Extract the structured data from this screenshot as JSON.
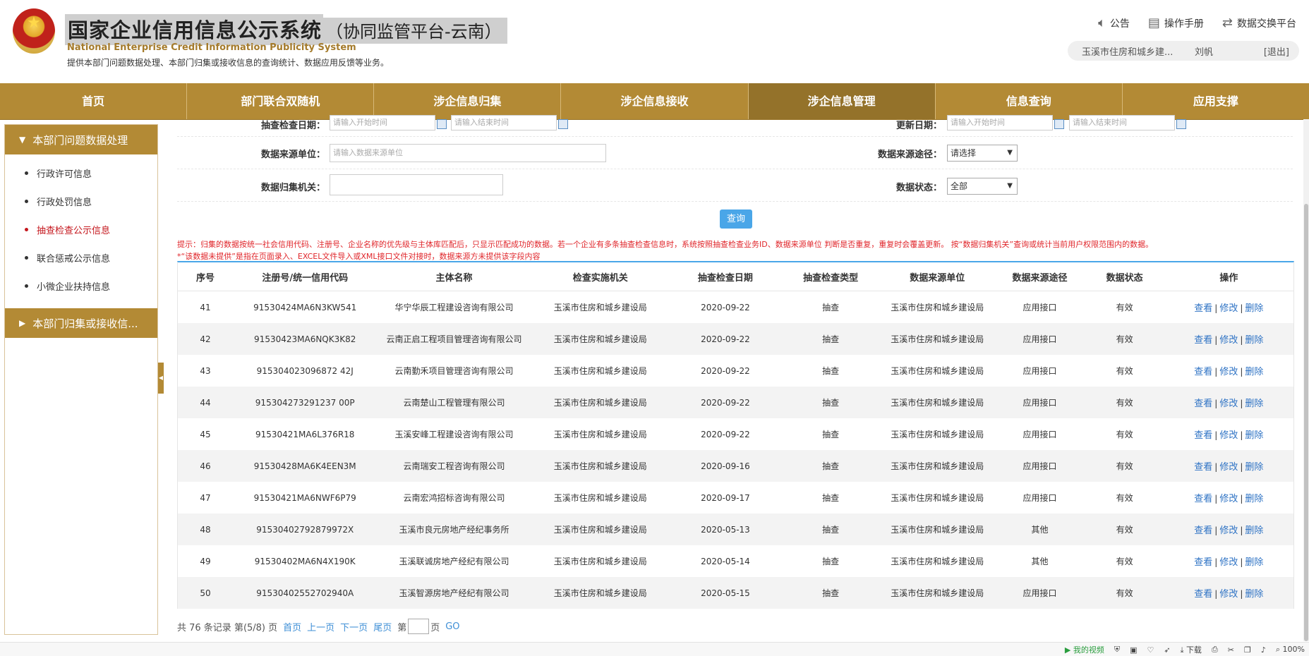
{
  "header": {
    "title_main": "国家企业信用信息公示系统",
    "title_sub": "（协同监管平台-云南）",
    "title_en": "National Enterprise Credit Information Publicity System",
    "description": "提供本部门问题数据处理、本部门归集或接收信息的查询统计、数据应用反馈等业务。",
    "links": [
      {
        "label": "公告",
        "icon": "speaker-icon"
      },
      {
        "label": "操作手册",
        "icon": "manual-icon"
      },
      {
        "label": "数据交换平台",
        "icon": "exchange-icon"
      }
    ],
    "user": {
      "dept": "玉溪市住房和城乡建...",
      "name": "刘帆",
      "logout": "[退出]"
    }
  },
  "nav": {
    "items": [
      "首页",
      "部门联合双随机",
      "涉企信息归集",
      "涉企信息接收",
      "涉企信息管理",
      "信息查询",
      "应用支撑"
    ],
    "active_index": 4
  },
  "sidebar": {
    "section1": "本部门问题数据处理",
    "items": [
      "行政许可信息",
      "行政处罚信息",
      "抽查检查公示信息",
      "联合惩戒公示信息",
      "小微企业扶持信息"
    ],
    "active_index": 2,
    "section2": "本部门归集或接收信..."
  },
  "filters": {
    "check_date_label": "抽查检查日期：",
    "start_placeholder": "请输入开始时间",
    "end_placeholder": "请输入结束时间",
    "update_date_label": "更新日期：",
    "update_start_placeholder": "请输入开始时间",
    "update_end_placeholder": "请输入结束时间",
    "source_unit_label": "数据来源单位：",
    "source_unit_placeholder": "请输入数据来源单位",
    "source_way_label": "数据来源途径：",
    "source_way_value": "请选择",
    "collect_org_label": "数据归集机关：",
    "collect_org_value": "",
    "status_label": "数据状态：",
    "status_value": "全部",
    "query_button": "查询"
  },
  "tips": {
    "line1": "提示：归集的数据按统一社会信用代码、注册号、企业名称的优先级与主体库匹配后，只显示匹配成功的数据。若一个企业有多条抽查检查信息时，系统按照抽查检查业务ID、数据来源单位 判断是否重复，重复时会覆盖更新。 按“数据归集机关”查询或统计当前用户权限范围内的数据。",
    "line2": "*“该数据未提供”是指在页面录入、EXCEL文件导入或XML接口文件对接时，数据来源方未提供该字段内容"
  },
  "table": {
    "headers": [
      "序号",
      "注册号/统一信用代码",
      "主体名称",
      "检查实施机关",
      "抽查检查日期",
      "抽查检查类型",
      "数据来源单位",
      "数据来源途径",
      "数据状态",
      "操作"
    ],
    "ops": {
      "view": "查看",
      "edit": "修改",
      "delete": "删除",
      "sep": "|"
    },
    "rows": [
      [
        "41",
        "91530424MA6N3KW541",
        "华宁华辰工程建设咨询有限公司",
        "玉溪市住房和城乡建设局",
        "2020-09-22",
        "抽查",
        "玉溪市住房和城乡建设局",
        "应用接口",
        "有效"
      ],
      [
        "42",
        "91530423MA6NQK3K82",
        "云南正启工程项目管理咨询有限公司",
        "玉溪市住房和城乡建设局",
        "2020-09-22",
        "抽查",
        "玉溪市住房和城乡建设局",
        "应用接口",
        "有效"
      ],
      [
        "43",
        "915304023096872 42J",
        "云南勤禾项目管理咨询有限公司",
        "玉溪市住房和城乡建设局",
        "2020-09-22",
        "抽查",
        "玉溪市住房和城乡建设局",
        "应用接口",
        "有效"
      ],
      [
        "44",
        "915304273291237 00P",
        "云南楚山工程管理有限公司",
        "玉溪市住房和城乡建设局",
        "2020-09-22",
        "抽查",
        "玉溪市住房和城乡建设局",
        "应用接口",
        "有效"
      ],
      [
        "45",
        "91530421MA6L376R18",
        "玉溪安峰工程建设咨询有限公司",
        "玉溪市住房和城乡建设局",
        "2020-09-22",
        "抽查",
        "玉溪市住房和城乡建设局",
        "应用接口",
        "有效"
      ],
      [
        "46",
        "91530428MA6K4EEN3M",
        "云南瑞安工程咨询有限公司",
        "玉溪市住房和城乡建设局",
        "2020-09-16",
        "抽查",
        "玉溪市住房和城乡建设局",
        "应用接口",
        "有效"
      ],
      [
        "47",
        "91530421MA6NWF6P79",
        "云南宏鸿招标咨询有限公司",
        "玉溪市住房和城乡建设局",
        "2020-09-17",
        "抽查",
        "玉溪市住房和城乡建设局",
        "应用接口",
        "有效"
      ],
      [
        "48",
        "91530402792879972X",
        "玉溪市良元房地产经纪事务所",
        "玉溪市住房和城乡建设局",
        "2020-05-13",
        "抽查",
        "玉溪市住房和城乡建设局",
        "其他",
        "有效"
      ],
      [
        "49",
        "91530402MA6N4X190K",
        "玉溪联诚房地产经纪有限公司",
        "玉溪市住房和城乡建设局",
        "2020-05-14",
        "抽查",
        "玉溪市住房和城乡建设局",
        "其他",
        "有效"
      ],
      [
        "50",
        "91530402552702940A",
        "玉溪智源房地产经纪有限公司",
        "玉溪市住房和城乡建设局",
        "2020-05-15",
        "抽查",
        "玉溪市住房和城乡建设局",
        "应用接口",
        "有效"
      ]
    ]
  },
  "pager": {
    "summary": "共 76 条记录 第(5/8) 页",
    "first": "首页",
    "prev": "上一页",
    "next": "下一页",
    "last": "尾页",
    "goto_prefix": "第",
    "goto_suffix": "页",
    "go": "GO"
  },
  "statusbar": {
    "video": "我的视频",
    "download": "下载",
    "zoom": "100%"
  }
}
